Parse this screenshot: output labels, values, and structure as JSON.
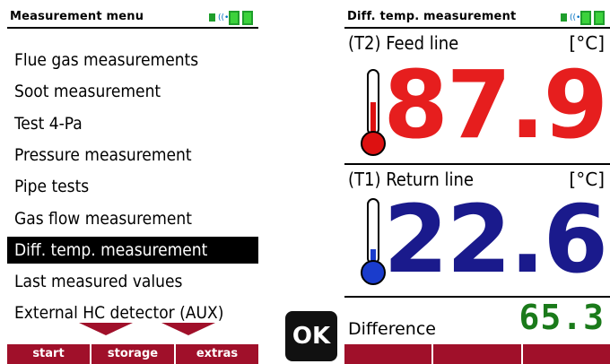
{
  "colors": {
    "softkey_bar": "#a0102a",
    "feed_value": "#e61e1e",
    "return_value": "#1a1a8c",
    "difference_value": "#1a7a1a",
    "thermo_hot": "#dd1111",
    "thermo_cold": "#1a3ccc",
    "battery": "#3cd23c"
  },
  "left_screen": {
    "title": "Measurement menu",
    "items": [
      {
        "label": "Flue gas measurements"
      },
      {
        "label": "Soot measurement"
      },
      {
        "label": "Test 4-Pa"
      },
      {
        "label": "Pressure measurement"
      },
      {
        "label": "Pipe tests"
      },
      {
        "label": "Gas flow measurement"
      },
      {
        "label": "Diff. temp. measurement",
        "selected": true
      },
      {
        "label": "Last measured values"
      },
      {
        "label": "External HC detector (AUX)"
      }
    ],
    "softkeys": [
      "start",
      "storage",
      "extras"
    ]
  },
  "ok_button": {
    "label": "OK"
  },
  "right_screen": {
    "title": "Diff. temp. measurement",
    "feed": {
      "label": "(T2) Feed line",
      "unit": "[°C]",
      "value": "87.9",
      "thermometer_icon": "thermometer-hot-icon"
    },
    "return": {
      "label": "(T1) Return line",
      "unit": "[°C]",
      "value": "22.6",
      "thermometer_icon": "thermometer-cold-icon"
    },
    "difference": {
      "label": "Difference",
      "value": "65.3"
    }
  }
}
